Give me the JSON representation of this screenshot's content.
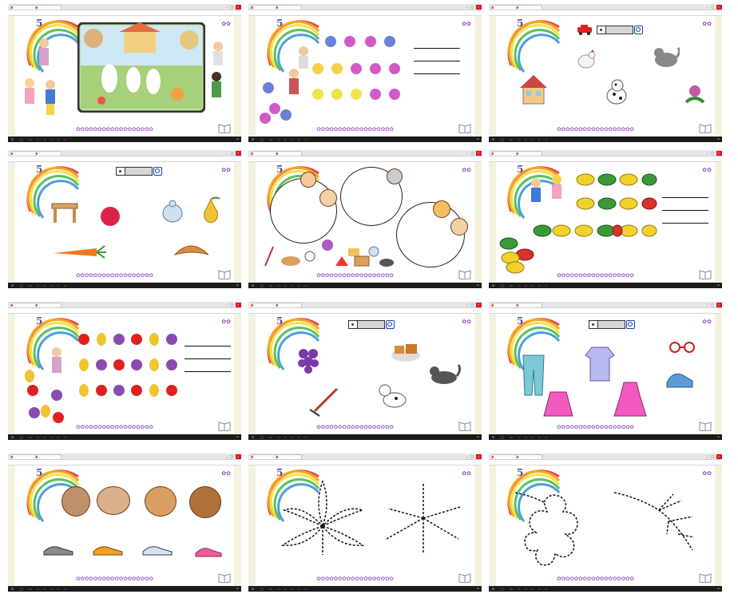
{
  "window": {
    "tab1": "",
    "tab2": "",
    "url": ""
  },
  "page_brand": "5",
  "colors": {
    "flowers": "#a46dc8",
    "recorder": "#1a3fb0",
    "close": "#e81123",
    "taskbar": "#1b1b1b"
  },
  "screens": [
    {
      "id": "p1",
      "content": [
        "garden-scene",
        "child-figures"
      ]
    },
    {
      "id": "p2",
      "content": [
        "flower-rows",
        "answer-blanks"
      ]
    },
    {
      "id": "p3",
      "content": [
        "car",
        "hen",
        "cat",
        "house",
        "dalmatian",
        "flower"
      ]
    },
    {
      "id": "p4",
      "content": [
        "table",
        "raspberry",
        "jug",
        "pear",
        "carrot",
        "croissant"
      ]
    },
    {
      "id": "p5",
      "content": [
        "sorting-circles",
        "faces",
        "objects"
      ]
    },
    {
      "id": "p6",
      "content": [
        "leaf-rows",
        "answer-blanks"
      ]
    },
    {
      "id": "p7",
      "content": [
        "fruit-rows",
        "answer-blanks"
      ]
    },
    {
      "id": "p8",
      "content": [
        "grapes",
        "pastry",
        "rake",
        "dog",
        "cat"
      ]
    },
    {
      "id": "p9",
      "content": [
        "trousers",
        "shirt",
        "skirt",
        "dress",
        "glasses",
        "sneakers"
      ]
    },
    {
      "id": "p10",
      "content": [
        "faces",
        "shoes"
      ]
    },
    {
      "id": "p11",
      "content": [
        "dotted-leaf",
        "dotted-star"
      ]
    },
    {
      "id": "p12",
      "content": [
        "dotted-oak-leaf",
        "dotted-twig"
      ]
    }
  ]
}
